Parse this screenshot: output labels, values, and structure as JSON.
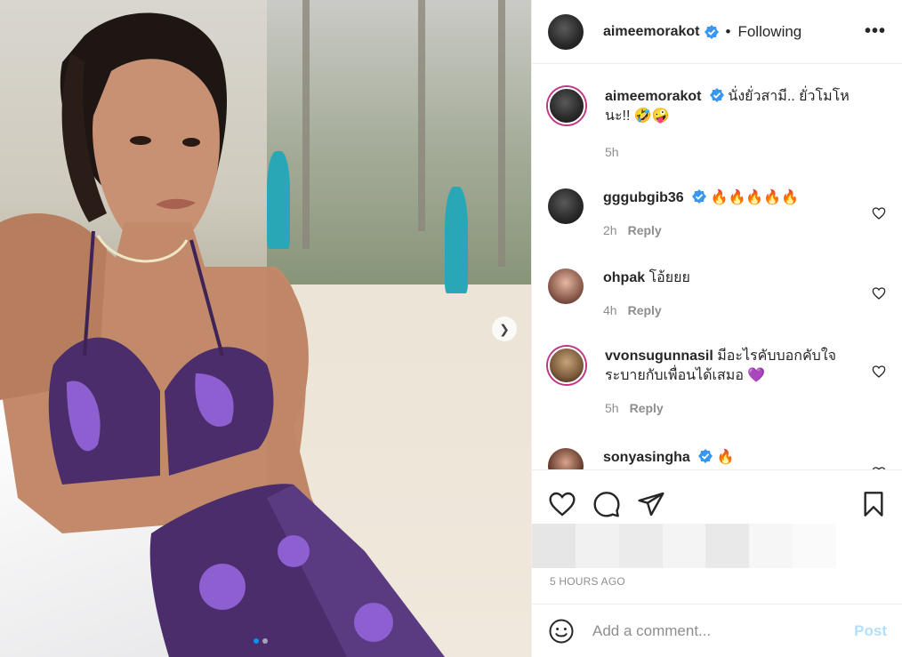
{
  "header": {
    "username": "aimeemorakot",
    "verified": true,
    "separator": "•",
    "follow_status": "Following",
    "more_icon": "more-horizontal-icon"
  },
  "caption": {
    "username": "aimeemorakot",
    "text": "นั่งยั่วสามี.. ยั่วโมโหนะ!! 🤣🤪",
    "time": "5h"
  },
  "comments": [
    {
      "username": "gggubgib36",
      "verified": true,
      "text": "🔥🔥🔥🔥🔥",
      "time": "2h",
      "reply_label": "Reply"
    },
    {
      "username": "ohpak",
      "verified": false,
      "text": "โอ้ยยย",
      "time": "4h",
      "reply_label": "Reply"
    },
    {
      "username": "vvonsugunnasil",
      "verified": false,
      "text": "มีอะไรคับบอกคับใจ ระบายกับเพื่อนได้เสมอ 💜",
      "time": "5h",
      "reply_label": "Reply"
    },
    {
      "username": "sonyasingha",
      "verified": true,
      "text": "🔥",
      "time": "",
      "reply_label": ""
    }
  ],
  "actions": {
    "like_icon": "heart-icon",
    "comment_icon": "comment-bubble-icon",
    "share_icon": "paper-plane-icon",
    "save_icon": "bookmark-icon"
  },
  "post_time": "5 HOURS AGO",
  "add_comment": {
    "placeholder": "Add a comment...",
    "post_label": "Post",
    "emoji_icon": "smiley-icon"
  },
  "carousel": {
    "current": 1,
    "total": 2,
    "next_icon": "chevron-right-icon"
  },
  "colors": {
    "verified": "#3897f0",
    "link": "#0095f6",
    "post_disabled": "#b2dffc",
    "muted": "#8e8e8e"
  }
}
